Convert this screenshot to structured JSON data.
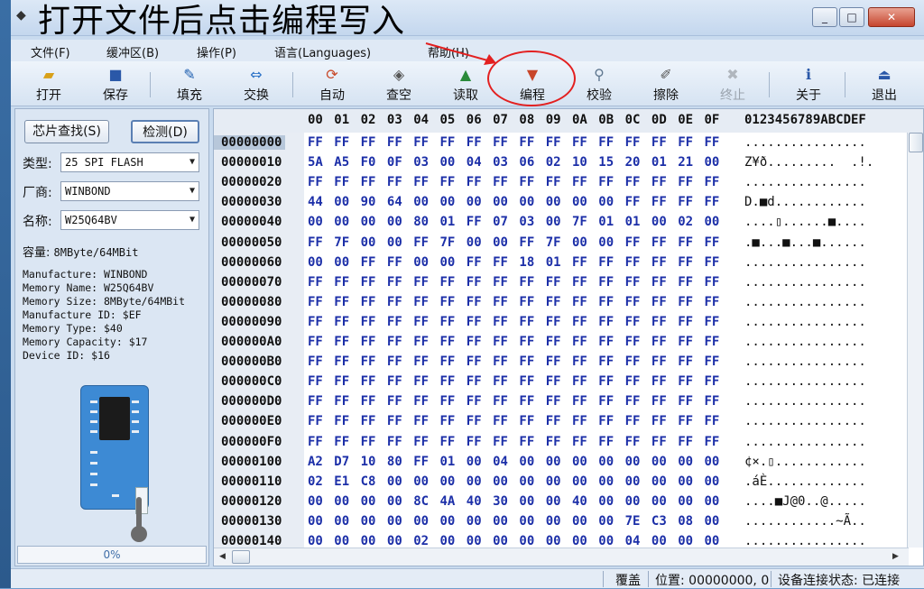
{
  "window": {
    "title": "",
    "annotation": "打开文件后点击编程写入",
    "buttons": {
      "minimize": "_",
      "maximize": "□",
      "close": "✕"
    }
  },
  "menu": [
    {
      "label": "文件(F)"
    },
    {
      "label": "缓冲区(B)"
    },
    {
      "label": "操作(P)"
    },
    {
      "label": "语言(Languages)"
    },
    {
      "label": "帮助(H)"
    }
  ],
  "toolbar": [
    {
      "label": "打开",
      "icon": "folder-open-icon",
      "glyph": "📂",
      "enabled": true
    },
    {
      "label": "保存",
      "icon": "floppy-save-icon",
      "glyph": "💾",
      "enabled": true
    },
    {
      "label": "填充",
      "icon": "fill-icon",
      "glyph": "✎",
      "enabled": true
    },
    {
      "label": "交换",
      "icon": "swap-arrows-icon",
      "glyph": "⇔",
      "enabled": true
    },
    {
      "label": "自动",
      "icon": "auto-icon",
      "glyph": "⟳",
      "enabled": true
    },
    {
      "label": "查空",
      "icon": "blank-check-icon",
      "glyph": "◈",
      "enabled": true
    },
    {
      "label": "读取",
      "icon": "read-icon",
      "glyph": "▲",
      "enabled": true
    },
    {
      "label": "编程",
      "icon": "program-icon",
      "glyph": "▼",
      "enabled": true
    },
    {
      "label": "校验",
      "icon": "verify-icon",
      "glyph": "🔍",
      "enabled": true
    },
    {
      "label": "擦除",
      "icon": "erase-icon",
      "glyph": "✐",
      "enabled": true
    },
    {
      "label": "终止",
      "icon": "stop-icon",
      "glyph": "✖",
      "enabled": false
    },
    {
      "label": "关于",
      "icon": "info-icon",
      "glyph": "ℹ",
      "enabled": true
    },
    {
      "label": "退出",
      "icon": "exit-icon",
      "glyph": "⏏",
      "enabled": true
    }
  ],
  "left": {
    "find_chip_button": "芯片查找(S)",
    "detect_button": "检测(D)",
    "type_label": "类型:",
    "type_value": "25 SPI FLASH",
    "vendor_label": "厂商:",
    "vendor_value": "WINBOND",
    "name_label": "名称:",
    "name_value": "W25Q64BV",
    "capacity_label": "容量:",
    "capacity_value": "8MByte/64MBit",
    "info_lines": [
      "Manufacture: WINBOND",
      "Memory Name: W25Q64BV",
      "Memory Size: 8MByte/64MBit",
      "Manufacture ID: $EF",
      "Memory Type: $40",
      "Memory Capacity: $17",
      "Device ID: $16"
    ],
    "progress": "0%"
  },
  "hex": {
    "columns": [
      "00",
      "01",
      "02",
      "03",
      "04",
      "05",
      "06",
      "07",
      "08",
      "09",
      "0A",
      "0B",
      "0C",
      "0D",
      "0E",
      "0F"
    ],
    "ascii_header": "0123456789ABCDEF",
    "rows": [
      {
        "addr": "00000000",
        "bytes": [
          "FF",
          "FF",
          "FF",
          "FF",
          "FF",
          "FF",
          "FF",
          "FF",
          "FF",
          "FF",
          "FF",
          "FF",
          "FF",
          "FF",
          "FF",
          "FF"
        ],
        "ascii": "................"
      },
      {
        "addr": "00000010",
        "bytes": [
          "5A",
          "A5",
          "F0",
          "0F",
          "03",
          "00",
          "04",
          "03",
          "06",
          "02",
          "10",
          "15",
          "20",
          "01",
          "21",
          "00"
        ],
        "ascii": "Z¥ð.........  .!."
      },
      {
        "addr": "00000020",
        "bytes": [
          "FF",
          "FF",
          "FF",
          "FF",
          "FF",
          "FF",
          "FF",
          "FF",
          "FF",
          "FF",
          "FF",
          "FF",
          "FF",
          "FF",
          "FF",
          "FF"
        ],
        "ascii": "................"
      },
      {
        "addr": "00000030",
        "bytes": [
          "44",
          "00",
          "90",
          "64",
          "00",
          "00",
          "00",
          "00",
          "00",
          "00",
          "00",
          "00",
          "FF",
          "FF",
          "FF",
          "FF"
        ],
        "ascii": "D.■d............"
      },
      {
        "addr": "00000040",
        "bytes": [
          "00",
          "00",
          "00",
          "00",
          "80",
          "01",
          "FF",
          "07",
          "03",
          "00",
          "7F",
          "01",
          "01",
          "00",
          "02",
          "00"
        ],
        "ascii": "....▯......■...."
      },
      {
        "addr": "00000050",
        "bytes": [
          "FF",
          "7F",
          "00",
          "00",
          "FF",
          "7F",
          "00",
          "00",
          "FF",
          "7F",
          "00",
          "00",
          "FF",
          "FF",
          "FF",
          "FF"
        ],
        "ascii": ".■...■...■......"
      },
      {
        "addr": "00000060",
        "bytes": [
          "00",
          "00",
          "FF",
          "FF",
          "00",
          "00",
          "FF",
          "FF",
          "18",
          "01",
          "FF",
          "FF",
          "FF",
          "FF",
          "FF",
          "FF"
        ],
        "ascii": "................"
      },
      {
        "addr": "00000070",
        "bytes": [
          "FF",
          "FF",
          "FF",
          "FF",
          "FF",
          "FF",
          "FF",
          "FF",
          "FF",
          "FF",
          "FF",
          "FF",
          "FF",
          "FF",
          "FF",
          "FF"
        ],
        "ascii": "................"
      },
      {
        "addr": "00000080",
        "bytes": [
          "FF",
          "FF",
          "FF",
          "FF",
          "FF",
          "FF",
          "FF",
          "FF",
          "FF",
          "FF",
          "FF",
          "FF",
          "FF",
          "FF",
          "FF",
          "FF"
        ],
        "ascii": "................"
      },
      {
        "addr": "00000090",
        "bytes": [
          "FF",
          "FF",
          "FF",
          "FF",
          "FF",
          "FF",
          "FF",
          "FF",
          "FF",
          "FF",
          "FF",
          "FF",
          "FF",
          "FF",
          "FF",
          "FF"
        ],
        "ascii": "................"
      },
      {
        "addr": "000000A0",
        "bytes": [
          "FF",
          "FF",
          "FF",
          "FF",
          "FF",
          "FF",
          "FF",
          "FF",
          "FF",
          "FF",
          "FF",
          "FF",
          "FF",
          "FF",
          "FF",
          "FF"
        ],
        "ascii": "................"
      },
      {
        "addr": "000000B0",
        "bytes": [
          "FF",
          "FF",
          "FF",
          "FF",
          "FF",
          "FF",
          "FF",
          "FF",
          "FF",
          "FF",
          "FF",
          "FF",
          "FF",
          "FF",
          "FF",
          "FF"
        ],
        "ascii": "................"
      },
      {
        "addr": "000000C0",
        "bytes": [
          "FF",
          "FF",
          "FF",
          "FF",
          "FF",
          "FF",
          "FF",
          "FF",
          "FF",
          "FF",
          "FF",
          "FF",
          "FF",
          "FF",
          "FF",
          "FF"
        ],
        "ascii": "................"
      },
      {
        "addr": "000000D0",
        "bytes": [
          "FF",
          "FF",
          "FF",
          "FF",
          "FF",
          "FF",
          "FF",
          "FF",
          "FF",
          "FF",
          "FF",
          "FF",
          "FF",
          "FF",
          "FF",
          "FF"
        ],
        "ascii": "................"
      },
      {
        "addr": "000000E0",
        "bytes": [
          "FF",
          "FF",
          "FF",
          "FF",
          "FF",
          "FF",
          "FF",
          "FF",
          "FF",
          "FF",
          "FF",
          "FF",
          "FF",
          "FF",
          "FF",
          "FF"
        ],
        "ascii": "................"
      },
      {
        "addr": "000000F0",
        "bytes": [
          "FF",
          "FF",
          "FF",
          "FF",
          "FF",
          "FF",
          "FF",
          "FF",
          "FF",
          "FF",
          "FF",
          "FF",
          "FF",
          "FF",
          "FF",
          "FF"
        ],
        "ascii": "................"
      },
      {
        "addr": "00000100",
        "bytes": [
          "A2",
          "D7",
          "10",
          "80",
          "FF",
          "01",
          "00",
          "04",
          "00",
          "00",
          "00",
          "00",
          "00",
          "00",
          "00",
          "00"
        ],
        "ascii": "¢×.▯............"
      },
      {
        "addr": "00000110",
        "bytes": [
          "02",
          "E1",
          "C8",
          "00",
          "00",
          "00",
          "00",
          "00",
          "00",
          "00",
          "00",
          "00",
          "00",
          "00",
          "00",
          "00"
        ],
        "ascii": ".áÈ............."
      },
      {
        "addr": "00000120",
        "bytes": [
          "00",
          "00",
          "00",
          "00",
          "8C",
          "4A",
          "40",
          "30",
          "00",
          "00",
          "40",
          "00",
          "00",
          "00",
          "00",
          "00"
        ],
        "ascii": "....■J@0..@....."
      },
      {
        "addr": "00000130",
        "bytes": [
          "00",
          "00",
          "00",
          "00",
          "00",
          "00",
          "00",
          "00",
          "00",
          "00",
          "00",
          "00",
          "7E",
          "C3",
          "08",
          "00"
        ],
        "ascii": "............~Ã.."
      },
      {
        "addr": "00000140",
        "bytes": [
          "00",
          "00",
          "00",
          "00",
          "02",
          "00",
          "00",
          "00",
          "00",
          "00",
          "00",
          "00",
          "04",
          "00",
          "00",
          "00"
        ],
        "ascii": "................"
      }
    ]
  },
  "status": {
    "mode": "覆盖",
    "position": "位置: 00000000, 0",
    "connection": "设备连接状态: 已连接"
  },
  "colors": {
    "hex_text": "#1c2fa8",
    "annotation_circle": "#e32020",
    "chip_board": "#3d8ad4"
  }
}
